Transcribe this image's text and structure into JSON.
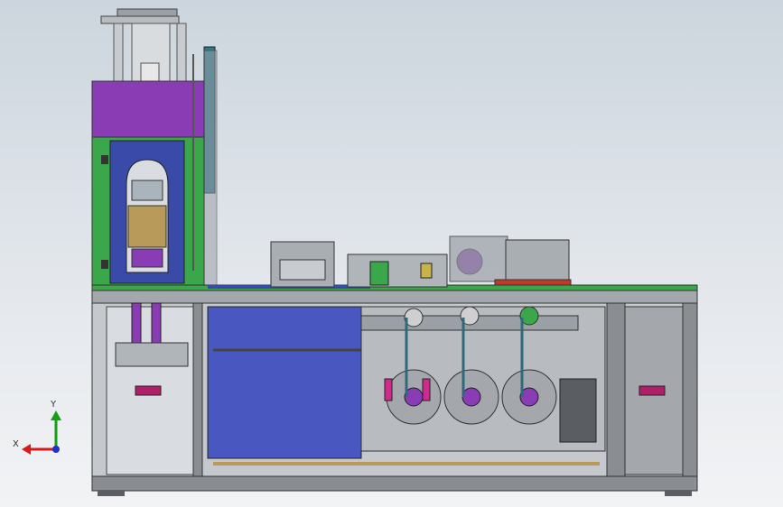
{
  "triad": {
    "x_label": "X",
    "y_label": "Y"
  },
  "colors": {
    "background_top": "#ccd5dd",
    "background_bottom": "#f2f3f5",
    "frame": "#8a8e92",
    "frame_dark": "#5a5e62",
    "purple": "#8a3cb4",
    "green": "#3aa84a",
    "blue_panel": "#3a4aa8",
    "magenta": "#d02a90",
    "teal_bar": "#2e7a8c",
    "gold": "#b89a5a",
    "axis_x": "#d81c1c",
    "axis_y": "#14a014",
    "axis_z": "#2030c8"
  }
}
